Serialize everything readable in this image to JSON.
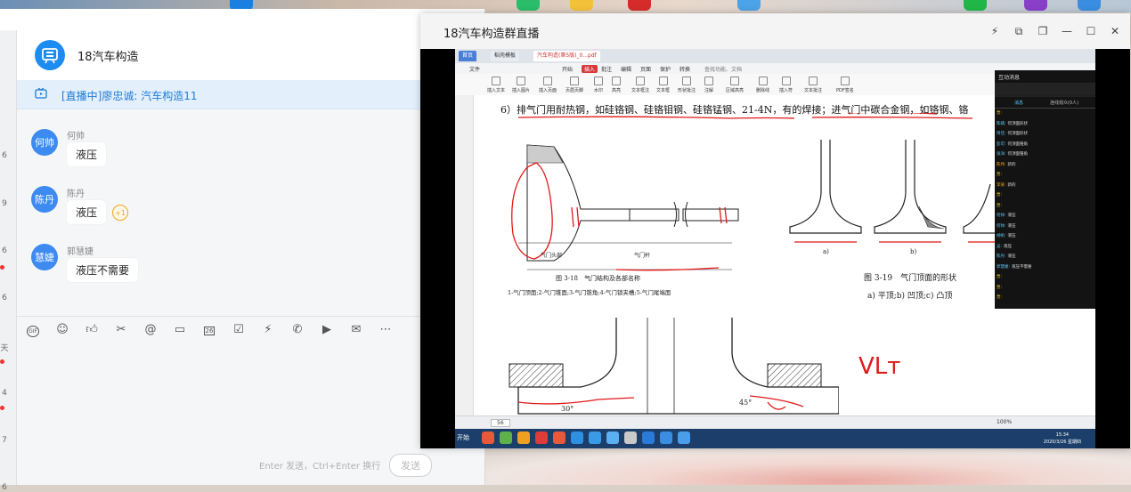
{
  "chat": {
    "group_name": "18汽车构造",
    "live_notice": "[直播中]廖忠诚: 汽车构造11",
    "left_numbers": [
      "6",
      "9",
      "6",
      "6",
      "天",
      "4",
      "7",
      "6"
    ],
    "messages": [
      {
        "name": "何帅",
        "avatar_text": "何帅",
        "avatar_color": "#3d8bf0",
        "text": "液压"
      },
      {
        "name": "陈丹",
        "avatar_text": "陈丹",
        "avatar_color": "#3d8bf0",
        "text": "液压",
        "plus_one": "+1"
      },
      {
        "name": "郭慧婕",
        "avatar_text": "慧婕",
        "avatar_color": "#3d8bf0",
        "text": "液压不需要"
      }
    ],
    "toolbar_icons": [
      "gif-icon",
      "emoji-icon",
      "thumbs-up-icon",
      "scissors-icon",
      "at-icon",
      "folder-icon",
      "calendar-icon",
      "check-icon",
      "lightning-icon",
      "phone-icon",
      "video-icon",
      "mail-icon",
      "more-icon"
    ],
    "calendar_day": "26",
    "gif_label": "GIF",
    "input_hint": "Enter 发送，Ctrl+Enter 换行",
    "send_label": "发送"
  },
  "live": {
    "title": "18汽车构造群直播",
    "screen": {
      "tabs": [
        "首页",
        "稻壳模板",
        "汽车构造(第5版)_0...pdf"
      ],
      "menu": [
        "文件",
        "开始",
        "插入",
        "批注",
        "编辑",
        "页面",
        "保护",
        "转换"
      ],
      "search": "查找功能、文档",
      "ribbon": [
        "插入文本",
        "插入图片",
        "插入页面",
        "页眉页脚",
        "水印",
        "高亮",
        "文本框注",
        "文本框",
        "形状批注",
        "注解",
        "区域高亮",
        "删除线",
        "插入符",
        "文本批注",
        "PDF签名"
      ],
      "doc_text": "6）排气门用耐热钢，如硅铬钢、硅铬钼钢、硅铬锰钢、21-4N，有的焊接；进气门中碳合金钢，如铬钢、铬",
      "fig18_caption": "图 3-18　气门结构及各部名称",
      "fig18_legend": "1-气门顶面;2-气门锥面;3-气门锥角;4-气门锁夹槽;5-气门尾端面",
      "fig18_label_head": "气门头部",
      "fig18_label_stem": "气门杆",
      "fig19_caption": "图 3-19　气门顶面的形状",
      "fig19_legend": "a) 平顶;b) 凹顶;c) 凸顶",
      "fig19_a": "a)",
      "fig19_b": "b)",
      "angle_30": "30°",
      "angle_45": "45°",
      "handwriting": "ꓦꓡт",
      "page": "56",
      "zoom": "100%",
      "start": "开始",
      "clock_time": "15:34",
      "clock_date": "2020/3/26 星期四"
    },
    "panel": {
      "title": "互动消息",
      "tab_chat": "消息",
      "tab_members": "连线观众(0人)",
      "messages": [
        {
          "who": "贾:",
          "text": "",
          "color": "#f0c000"
        },
        {
          "who": "陈楠:",
          "text": "何顶面形状",
          "color": "#4fc3f7"
        },
        {
          "who": "周佳:",
          "text": "何顶面形状",
          "color": "#4fc3f7"
        },
        {
          "who": "彭可:",
          "text": "何顶面锥角",
          "color": "#4fc3f7"
        },
        {
          "who": "张洋:",
          "text": "何顶面锥角",
          "color": "#4fc3f7"
        },
        {
          "who": "陈伟:",
          "text": "新的",
          "color": "#f0a000"
        },
        {
          "who": "贾:",
          "text": "",
          "color": "#f0c000"
        },
        {
          "who": "李某:",
          "text": "新的",
          "color": "#f0a000"
        },
        {
          "who": "贾:",
          "text": "",
          "color": "#f0c000"
        },
        {
          "who": "贾:",
          "text": "",
          "color": "#f0c000"
        },
        {
          "who": "何帅:",
          "text": "液压",
          "color": "#4fc3f7"
        },
        {
          "who": "何帅:",
          "text": "液压",
          "color": "#4fc3f7"
        },
        {
          "who": "杨帆:",
          "text": "液压",
          "color": "#4fc3f7"
        },
        {
          "who": "吴:",
          "text": "液压",
          "color": "#4fc3f7"
        },
        {
          "who": "陈丹:",
          "text": "液压",
          "color": "#4fc3f7"
        },
        {
          "who": "郭慧婕:",
          "text": "液压不需要",
          "color": "#4fc3f7"
        },
        {
          "who": "贾:",
          "text": "",
          "color": "#f0c000"
        },
        {
          "who": "贾:",
          "text": "",
          "color": "#f0c000"
        },
        {
          "who": "贾:",
          "text": "",
          "color": "#f0c000"
        }
      ]
    }
  }
}
